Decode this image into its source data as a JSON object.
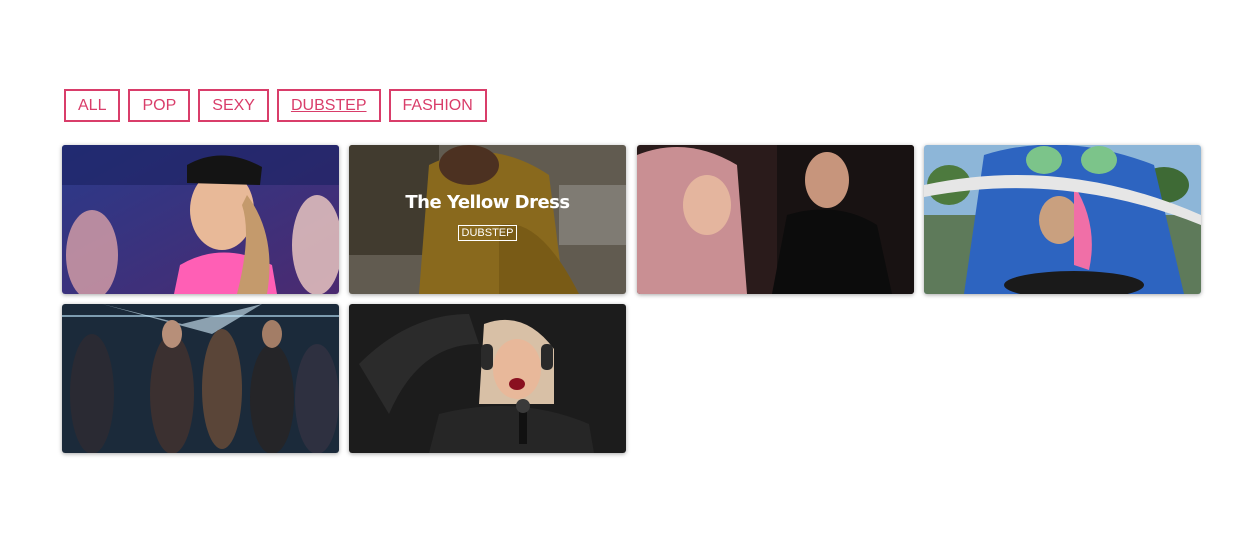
{
  "filters": [
    {
      "label": "ALL"
    },
    {
      "label": "POP"
    },
    {
      "label": "SEXY"
    },
    {
      "label": "DUBSTEP",
      "active": true
    },
    {
      "label": "FASHION"
    }
  ],
  "gallery": {
    "items": [
      {
        "image": "girl-in-icon-cap-dancing"
      },
      {
        "image": "woman-in-yellow-dress",
        "title": "The Yellow Dress",
        "tag": "DUBSTEP"
      },
      {
        "image": "couple-pink-hair"
      },
      {
        "image": "man-in-mascot-costume-driving"
      },
      {
        "image": "group-dancing-neon-club"
      },
      {
        "image": "singer-with-headphones-microphone"
      }
    ]
  },
  "colors": {
    "accent": "#d93d6a"
  }
}
